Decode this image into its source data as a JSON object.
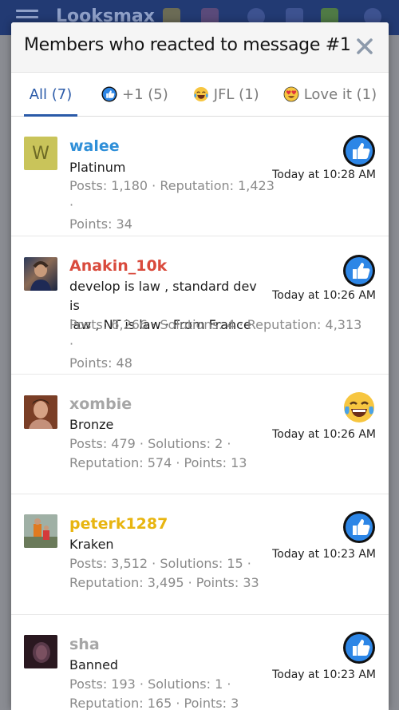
{
  "background": {
    "brand": "Looksmax"
  },
  "modal": {
    "title": "Members who reacted to message #1",
    "tabs": [
      {
        "label": "All (7)",
        "active": true
      },
      {
        "label": "+1 (5)",
        "icon": "thumbs-up-icon"
      },
      {
        "label": "JFL (1)",
        "icon": "laughing-crying-face-icon"
      },
      {
        "label": "Love it (1)",
        "icon": "heart-eyes-face-icon"
      }
    ],
    "members": [
      {
        "username": "walee",
        "name_color": "#2f8fd8",
        "avatar_letter": "W",
        "title": "Platinum",
        "stats_line1": "Posts: 1,180 · Reputation: 1,423 ·",
        "stats_line2": "Points: 34",
        "reaction": "thumbs-up-icon",
        "time": "Today at 10:28 AM"
      },
      {
        "username": "Anakin_10k",
        "name_color": "#d94a3c",
        "title_line1": "develop is law , standard dev is",
        "title_line2": "law , NT is law · From France",
        "stats_line1": "Posts: 6,266 · Solutions: 4 · Reputation: 4,313 ·",
        "stats_line2": "Points: 48",
        "reaction": "thumbs-up-icon",
        "time": "Today at 10:26 AM"
      },
      {
        "username": "xombie",
        "name_color": "#a6a6a6",
        "title": "Bronze",
        "stats_line1": "Posts: 479 · Solutions: 2 ·",
        "stats_line2": "Reputation: 574 · Points: 13",
        "reaction": "laughing-crying-face-icon",
        "time": "Today at 10:26 AM"
      },
      {
        "username": "peterk1287",
        "name_color": "#e8b510",
        "title": "Kraken",
        "stats_line1": "Posts: 3,512 · Solutions: 15 ·",
        "stats_line2": "Reputation: 3,495 · Points: 33",
        "reaction": "thumbs-up-icon",
        "time": "Today at 10:23 AM"
      },
      {
        "username": "sha",
        "name_color": "#a6a6a6",
        "title": "Banned",
        "stats_line1": "Posts: 193 · Solutions: 1 ·",
        "stats_line2": "Reputation: 165 · Points: 3",
        "reaction": "thumbs-up-icon",
        "time": "Today at 10:23 AM"
      }
    ]
  }
}
